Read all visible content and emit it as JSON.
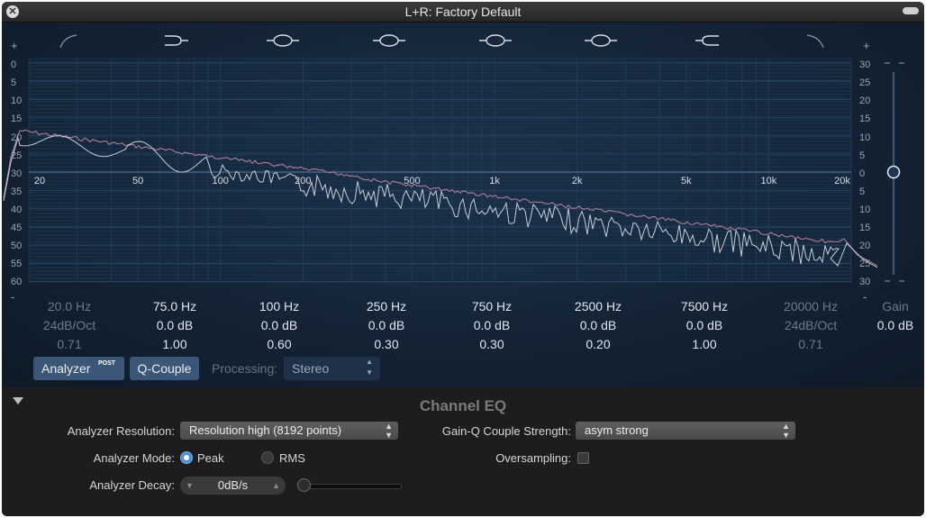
{
  "window": {
    "title": "L+R: Factory Default"
  },
  "scale": {
    "left_top": "+",
    "left_bottom": "-",
    "left": [
      "0",
      "5",
      "10",
      "15",
      "20",
      "25",
      "30",
      "35",
      "40",
      "45",
      "50",
      "55",
      "60"
    ],
    "right_top": "+",
    "right_bottom": "-",
    "right": [
      "30",
      "25",
      "20",
      "15",
      "10",
      "5",
      "0",
      "5",
      "10",
      "15",
      "20",
      "25",
      "30"
    ],
    "freq": [
      "20",
      "50",
      "100",
      "200",
      "500",
      "1k",
      "2k",
      "5k",
      "10k",
      "20k"
    ]
  },
  "bands": [
    {
      "name": "lowcut",
      "freq": "20.0 Hz",
      "gain": "24dB/Oct",
      "q": "0.71",
      "enabled": false
    },
    {
      "name": "lowshelf",
      "freq": "75.0 Hz",
      "gain": "0.0 dB",
      "q": "1.00",
      "enabled": true
    },
    {
      "name": "peak1",
      "freq": "100 Hz",
      "gain": "0.0 dB",
      "q": "0.60",
      "enabled": true
    },
    {
      "name": "peak2",
      "freq": "250 Hz",
      "gain": "0.0 dB",
      "q": "0.30",
      "enabled": true
    },
    {
      "name": "peak3",
      "freq": "750 Hz",
      "gain": "0.0 dB",
      "q": "0.30",
      "enabled": true
    },
    {
      "name": "peak4",
      "freq": "2500 Hz",
      "gain": "0.0 dB",
      "q": "0.20",
      "enabled": true
    },
    {
      "name": "highshelf",
      "freq": "7500 Hz",
      "gain": "0.0 dB",
      "q": "1.00",
      "enabled": true
    },
    {
      "name": "highcut",
      "freq": "20000 Hz",
      "gain": "24dB/Oct",
      "q": "0.71",
      "enabled": false
    }
  ],
  "master_gain": {
    "label": "Gain",
    "value": "0.0 dB"
  },
  "toolbar": {
    "analyzer_label": "Analyzer",
    "analyzer_badge": "POST",
    "qcouple_label": "Q-Couple",
    "processing_label": "Processing:",
    "processing_value": "Stereo"
  },
  "plugin": {
    "name": "Channel EQ"
  },
  "settings": {
    "analyzer_resolution_label": "Analyzer Resolution:",
    "analyzer_resolution_value": "Resolution high (8192 points)",
    "analyzer_mode_label": "Analyzer Mode:",
    "mode_peak": "Peak",
    "mode_rms": "RMS",
    "mode_selected": "Peak",
    "analyzer_decay_label": "Analyzer Decay:",
    "analyzer_decay_value": "0dB/s",
    "gainq_label": "Gain-Q Couple Strength:",
    "gainq_value": "asym strong",
    "oversampling_label": "Oversampling:",
    "oversampling_checked": false
  },
  "colors": {
    "accent": "#4f8fd6",
    "button": "#3c5677",
    "curve": "#c7ced8",
    "peak_hold": "#a07a92"
  }
}
